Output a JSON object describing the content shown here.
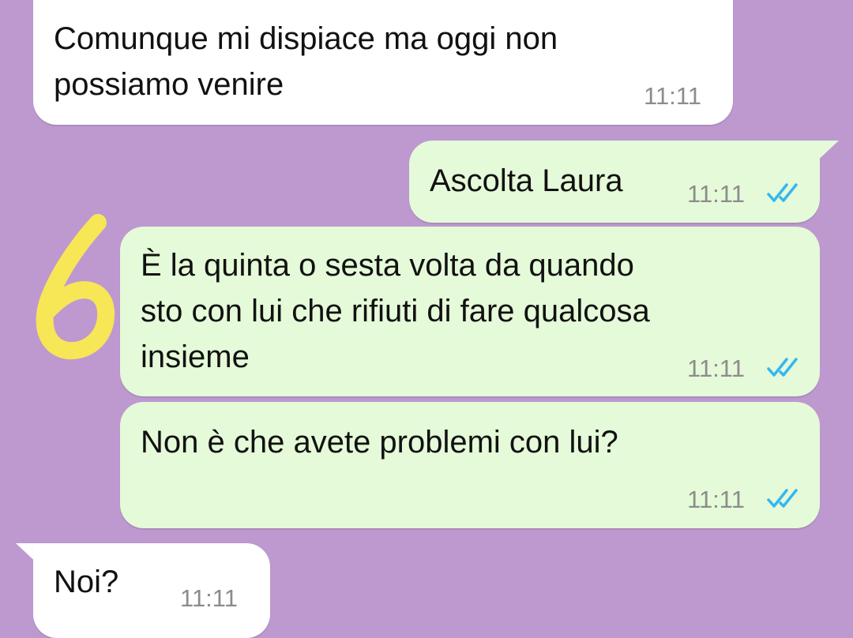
{
  "theme": {
    "background": "#BE99D0",
    "incoming_bubble": "#FFFFFF",
    "outgoing_bubble": "#E5FAD8",
    "read_tick_color": "#34B7F1",
    "annotation_color": "#F7E656"
  },
  "annotation": {
    "icon": "handwritten-six-icon"
  },
  "messages": [
    {
      "direction": "incoming",
      "text": "Comunque mi dispiace ma oggi non\npossiamo venire",
      "time": "11:11"
    },
    {
      "direction": "outgoing",
      "text": "Ascolta Laura",
      "time": "11:11",
      "status_icon": "double-check-read-icon"
    },
    {
      "direction": "outgoing",
      "text": "È la quinta o sesta volta da quando\nsto con lui che rifiuti di fare qualcosa\ninsieme",
      "time": "11:11",
      "status_icon": "double-check-read-icon"
    },
    {
      "direction": "outgoing",
      "text": "Non è che avete problemi con lui?",
      "time": "11:11",
      "status_icon": "double-check-read-icon"
    },
    {
      "direction": "incoming",
      "text": "Noi?",
      "time": "11:11"
    }
  ]
}
